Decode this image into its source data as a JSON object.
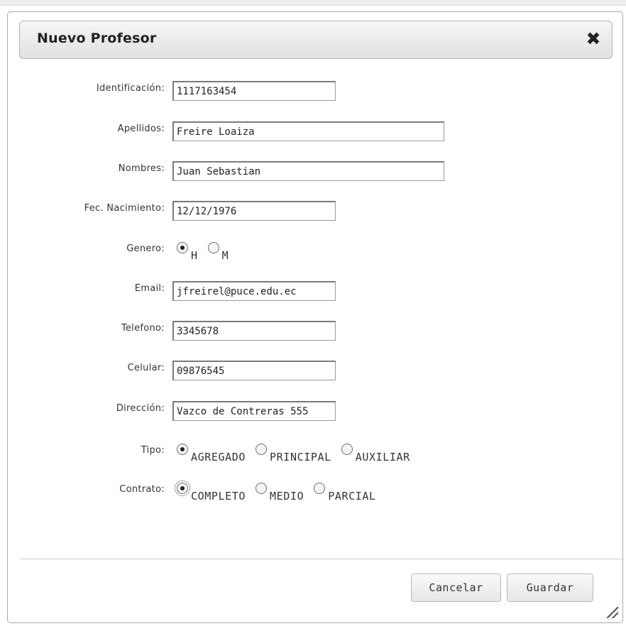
{
  "dialog": {
    "title": "Nuevo Profesor",
    "close_glyph": "✖"
  },
  "form": {
    "identificacion": {
      "label": "Identificación:",
      "value": "1117163454"
    },
    "apellidos": {
      "label": "Apellidos:",
      "value": "Freire Loaiza"
    },
    "nombres": {
      "label": "Nombres:",
      "value": "Juan Sebastian"
    },
    "fec_nacimiento": {
      "label": "Fec. Nacimiento:",
      "value": "12/12/1976"
    },
    "genero": {
      "label": "Genero:",
      "options": [
        "H",
        "M"
      ],
      "selected": "H"
    },
    "email": {
      "label": "Email:",
      "value": "jfreirel@puce.edu.ec"
    },
    "telefono": {
      "label": "Telefono:",
      "value": "3345678"
    },
    "celular": {
      "label": "Celular:",
      "value": "09876545"
    },
    "direccion": {
      "label": "Dirección:",
      "value": "Vazco de Contreras 555"
    },
    "tipo": {
      "label": "Tipo:",
      "options": [
        "AGREGADO",
        "PRINCIPAL",
        "AUXILIAR"
      ],
      "selected": "AGREGADO"
    },
    "contrato": {
      "label": "Contrato:",
      "options": [
        "COMPLETO",
        "MEDIO",
        "PARCIAL"
      ],
      "selected": "COMPLETO"
    }
  },
  "buttons": {
    "cancel": "Cancelar",
    "save": "Guardar"
  },
  "icons": {
    "close": "close-icon",
    "radio": "radio-icon",
    "resize": "resize-grip-icon"
  }
}
